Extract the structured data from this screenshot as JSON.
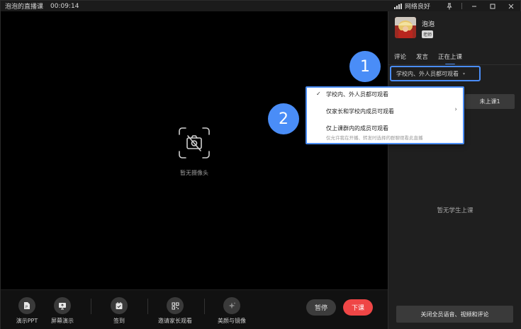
{
  "titlebar": {
    "title": "泡泡的直播课",
    "timer": "00:09:14",
    "network": "网络良好"
  },
  "stage": {
    "no_camera": "暂无摄像头"
  },
  "toolbar": {
    "items": [
      {
        "label": "演示PPT",
        "icon": "ppt-icon"
      },
      {
        "label": "屏幕演示",
        "icon": "screen-share-icon"
      },
      {
        "label": "签到",
        "icon": "check-in-icon"
      },
      {
        "label": "邀请家长观看",
        "icon": "qr-code-icon"
      },
      {
        "label": "美颜与镜像",
        "icon": "beauty-sparkle-icon"
      }
    ],
    "pause": "暂停",
    "end_class": "下课"
  },
  "panel": {
    "user_name": "泡泡",
    "role": "老师",
    "tabs": [
      "评论",
      "发言",
      "正在上课"
    ],
    "active_tab": 2,
    "visibility_selected": "学校内、外人员都可观看",
    "class_button": "未上课1",
    "empty_text": "暂无学生上课",
    "mute_all": "关闭全员语音、视频和评论"
  },
  "dropdown": {
    "options": [
      {
        "label": "学校内、外人员都可观看",
        "checked": true
      },
      {
        "label": "仅家长和学校内成员可观看",
        "has_submenu": true
      },
      {
        "label": "仅上课群内的成员可观看",
        "sub": "仅允许我在开播、转发时选择的群聊观看此直播"
      }
    ]
  },
  "callouts": [
    "1",
    "2"
  ],
  "colors": {
    "accent": "#4a8df7",
    "danger": "#ef4646",
    "panel_bg": "#1f1f1f"
  }
}
